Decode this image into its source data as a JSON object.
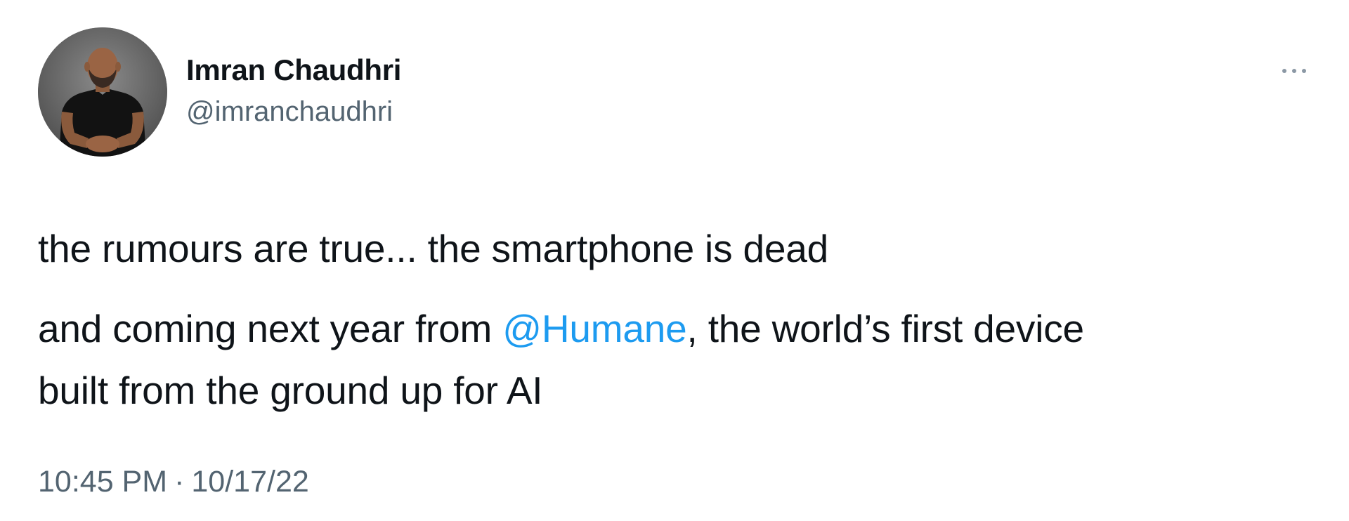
{
  "author": {
    "name": "Imran Chaudhri",
    "handle": "@imranchaudhri",
    "avatar_icon": "person-photo-avatar"
  },
  "more_icon": "ellipsis-icon",
  "tweet": {
    "line1": "the rumours are true... the smartphone is dead",
    "line2_before_mention": "and coming next year from ",
    "mention": "@Humane",
    "line2_after_mention": ", the world’s first device",
    "line3": "built from the ground up for AI"
  },
  "meta": {
    "time": "10:45 PM",
    "separator": "·",
    "date": "10/17/22"
  },
  "colors": {
    "text": "#0f1419",
    "secondary": "#536471",
    "link": "#1d9bf0",
    "background": "#ffffff"
  }
}
